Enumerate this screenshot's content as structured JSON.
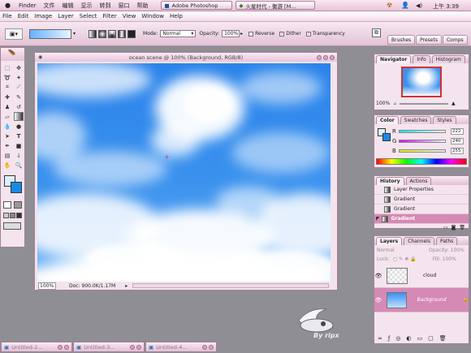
{
  "system_bar": {
    "menus": [
      "Finder",
      "文件",
      "编辑",
      "显示",
      "转到",
      "窗口",
      "帮助"
    ],
    "active_app": "Adobe Photoshop",
    "task_item": "火星时代 - 衡游 [M...",
    "time": "上午 3:39"
  },
  "menubar": {
    "items": [
      "File",
      "Edit",
      "Image",
      "Layer",
      "Select",
      "Filter",
      "View",
      "Window",
      "Help"
    ]
  },
  "options_bar": {
    "mode_label": "Mode:",
    "mode_value": "Normal",
    "opacity_label": "Opacity:",
    "opacity_value": "100%",
    "reverse_label": "Reverse",
    "dither_label": "Dither",
    "transparency_label": "Transparency",
    "reverse_checked": false,
    "dither_checked": true,
    "transparency_checked": true,
    "palette_tabs": [
      "Brushes",
      "Presets",
      "Comps"
    ]
  },
  "document": {
    "title": "ocean scene @ 100% (Background, RGB/8)",
    "zoom": "100%",
    "doc_size": "Doc: 900.0K/1.17M"
  },
  "navigator": {
    "tabs": [
      "Navigator",
      "Info",
      "Histogram"
    ],
    "zoom": "100%"
  },
  "color_panel": {
    "tabs": [
      "Color",
      "Swatches",
      "Styles"
    ],
    "channels": [
      {
        "label": "R",
        "value": "222"
      },
      {
        "label": "G",
        "value": "240"
      },
      {
        "label": "B",
        "value": "255"
      }
    ]
  },
  "history_panel": {
    "tabs": [
      "History",
      "Actions"
    ],
    "items": [
      "Layer Properties",
      "Gradient",
      "Gradient",
      "Gradient"
    ]
  },
  "layers_panel": {
    "tabs": [
      "Layers",
      "Channels",
      "Paths"
    ],
    "blend_mode": "Normal",
    "opacity_label": "Opacity:",
    "opacity_value": "100%",
    "lock_label": "Lock:",
    "fill_label": "Fill:",
    "fill_value": "100%",
    "layers": [
      {
        "name": "cloud"
      },
      {
        "name": "Background"
      }
    ]
  },
  "minimized_windows": [
    "Untitled-2...",
    "Untitled-3...",
    "Untitled-4..."
  ],
  "watermark": {
    "text": "By ripx"
  },
  "colors": {
    "accent_pink": "#e6c4d8",
    "sky_blue": "#2d88ea"
  }
}
